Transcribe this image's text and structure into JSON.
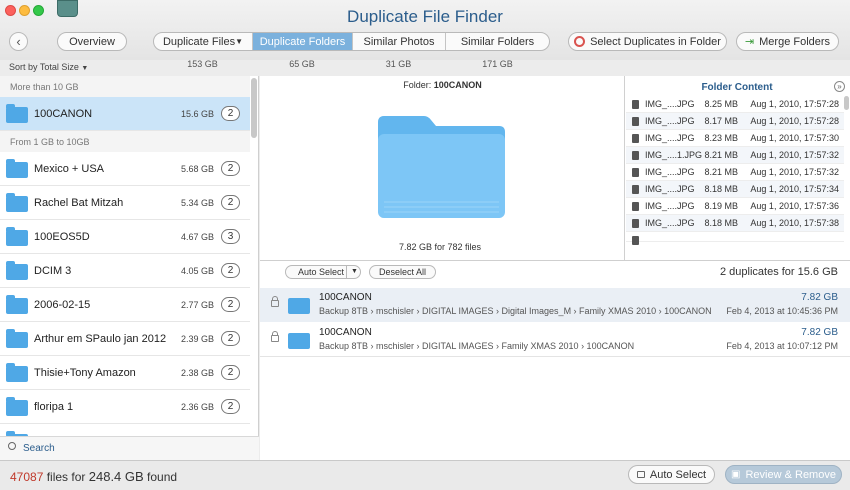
{
  "window": {
    "title": "Duplicate File Finder"
  },
  "toolbar": {
    "overview": "Overview",
    "tabs": [
      {
        "label": "Duplicate Files",
        "size": "153 GB",
        "dropdown": true,
        "selected": false
      },
      {
        "label": "Duplicate Folders",
        "size": "65 GB",
        "selected": true
      },
      {
        "label": "Similar Photos",
        "size": "31 GB",
        "selected": false
      },
      {
        "label": "Similar Folders",
        "size": "171 GB",
        "selected": false
      }
    ],
    "select_duplicates": "Select Duplicates in Folder",
    "merge_folders": "Merge Folders"
  },
  "sidebar": {
    "sort_label": "Sort by Total Size",
    "sections": [
      "More than 10 GB",
      "From 1 GB to 10GB"
    ],
    "items": [
      {
        "name": "100CANON",
        "size": "15.6 GB",
        "count": "2"
      },
      {
        "name": "Mexico + USA",
        "size": "5.68 GB",
        "count": "2"
      },
      {
        "name": "Rachel Bat Mitzah",
        "size": "5.34 GB",
        "count": "2"
      },
      {
        "name": "100EOS5D",
        "size": "4.67 GB",
        "count": "3"
      },
      {
        "name": "DCIM 3",
        "size": "4.05 GB",
        "count": "2"
      },
      {
        "name": "2006-02-15",
        "size": "2.77 GB",
        "count": "2"
      },
      {
        "name": "Arthur em SPaulo jan 2012",
        "size": "2.39 GB",
        "count": "2"
      },
      {
        "name": "Thisie+Tony Amazon",
        "size": "2.38 GB",
        "count": "2"
      },
      {
        "name": "floripa 1",
        "size": "2.36 GB",
        "count": "2"
      }
    ],
    "search_placeholder": "Search"
  },
  "preview": {
    "label": "Folder:",
    "folder": "100CANON",
    "caption": "7.82 GB for 782 files"
  },
  "folder_content": {
    "title": "Folder Content",
    "files": [
      {
        "name": "IMG_....JPG",
        "size": "8.25 MB",
        "date": "Aug 1, 2010, 17:57:28"
      },
      {
        "name": "IMG_....JPG",
        "size": "8.17 MB",
        "date": "Aug 1, 2010, 17:57:28"
      },
      {
        "name": "IMG_....JPG",
        "size": "8.23 MB",
        "date": "Aug 1, 2010, 17:57:30"
      },
      {
        "name": "IMG_....1.JPG",
        "size": "8.21 MB",
        "date": "Aug 1, 2010, 17:57:32"
      },
      {
        "name": "IMG_....JPG",
        "size": "8.21 MB",
        "date": "Aug 1, 2010, 17:57:32"
      },
      {
        "name": "IMG_....JPG",
        "size": "8.18 MB",
        "date": "Aug 1, 2010, 17:57:34"
      },
      {
        "name": "IMG_....JPG",
        "size": "8.19 MB",
        "date": "Aug 1, 2010, 17:57:36"
      },
      {
        "name": "IMG_....JPG",
        "size": "8.18 MB",
        "date": "Aug 1, 2010, 17:57:38"
      }
    ]
  },
  "duplicates": {
    "auto_select": "Auto Select",
    "deselect_all": "Deselect All",
    "summary": "2 duplicates for 15.6 GB",
    "rows": [
      {
        "name": "100CANON",
        "path": "Backup 8TB  ›  mschisler  ›  DIGITAL IMAGES  ›  Digital Images_M  ›  Family XMAS 2010  ›  100CANON",
        "size": "7.82 GB",
        "date": "Feb 4, 2013 at 10:45:36 PM"
      },
      {
        "name": "100CANON",
        "path": "Backup 8TB  ›  mschisler  ›  DIGITAL IMAGES  ›  Family XMAS 2010  ›  100CANON",
        "size": "7.82 GB",
        "date": "Feb 4, 2013 at 10:07:12 PM"
      }
    ]
  },
  "status": {
    "files_count": "47087",
    "files_text": "files for",
    "total": "248.4 GB",
    "found": "found",
    "auto_select": "Auto Select",
    "review_remove": "Review & Remove"
  },
  "colors": {
    "accent": "#2b5d8c",
    "selected_tab": "#7bb1dd",
    "folder": "#4fa8e6",
    "count_red": "#c0392b"
  }
}
